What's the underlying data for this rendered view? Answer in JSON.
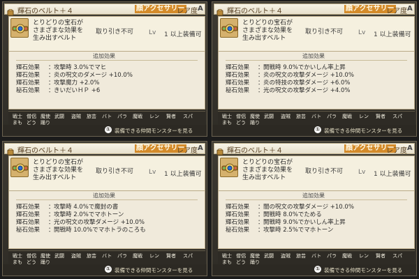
{
  "panels": [
    {
      "title": "輝石のベルト＋４",
      "badge": "顔アクセサリー",
      "rarity_label": "レア度",
      "rarity_value": "A",
      "desc": [
        "とりどりの宝石が",
        "さまざまな効果を",
        "生み出すベルト"
      ],
      "trade": "取り引き不可",
      "level_label": "Lv",
      "level_value": "1 以上装備可",
      "effects_title": "追加効果",
      "effects": [
        {
          "name": "輝石効果",
          "value": "攻撃時 3.0%でマヒ"
        },
        {
          "name": "輝石効果",
          "value": "炎の呪文のダメージ +10.0%"
        },
        {
          "name": "輝石効果",
          "value": "攻撃魔力 +2.0%"
        },
        {
          "name": "秘石効果",
          "value": "きいだいＨＰ +6"
        }
      ],
      "classes_row1": [
        "戦士",
        "僧侶",
        "魔使",
        "武闘",
        "盗賊",
        "旅芸",
        "バト",
        "パラ",
        "魔戦",
        "レン",
        "賢者",
        "スパ"
      ],
      "classes_row2": [
        "まも",
        "どう",
        "踊り"
      ],
      "footer": "装備できる仲間モンスターを見る",
      "footer_icon": "①"
    },
    {
      "title": "輝石のベルト＋４",
      "badge": "顔アクセサリー",
      "rarity_label": "レア度",
      "rarity_value": "A",
      "desc": [
        "とりどりの宝石が",
        "さまざまな効果を",
        "生み出すベルト"
      ],
      "trade": "取り引き不可",
      "level_label": "Lv",
      "level_value": "1 以上装備可",
      "effects_title": "追加効果",
      "effects": [
        {
          "name": "輝石効果",
          "value": "開戦時 9.0%でかいしん率上昇"
        },
        {
          "name": "輝石効果",
          "value": "炎の呪文の攻撃ダメージ +10.0%"
        },
        {
          "name": "輝石効果",
          "value": "炎の特技の攻撃ダメージ +6.0%"
        },
        {
          "name": "秘石効果",
          "value": "光の呪文の攻撃ダメージ +4.0%"
        }
      ],
      "classes_row1": [
        "戦士",
        "僧侶",
        "魔使",
        "武闘",
        "盗賊",
        "旅芸",
        "バト",
        "パラ",
        "魔戦",
        "レン",
        "賢者",
        "スパ"
      ],
      "classes_row2": [
        "まも",
        "どう",
        "踊り"
      ],
      "footer": "装備できる仲間モンスターを見る",
      "footer_icon": "①"
    },
    {
      "title": "輝石のベルト＋４",
      "badge": "顔アクセサリー",
      "rarity_label": "レア度",
      "rarity_value": "A",
      "desc": [
        "とりどりの宝石が",
        "さまざまな効果を",
        "生み出すベルト"
      ],
      "trade": "取り引き不可",
      "level_label": "Lv",
      "level_value": "1 以上装備可",
      "effects_title": "追加効果",
      "effects": [
        {
          "name": "輝石効果",
          "value": "攻撃時 4.0%で魔封の書"
        },
        {
          "name": "輝石効果",
          "value": "攻撃時 2.0%でマホトーン"
        },
        {
          "name": "輝石効果",
          "value": "光の呪文の攻撃ダメージ +10.0%"
        },
        {
          "name": "秘石効果",
          "value": "開戦時 10.0%でマホトラのころも"
        }
      ],
      "classes_row1": [
        "戦士",
        "僧侶",
        "魔使",
        "武闘",
        "盗賊",
        "旅芸",
        "バト",
        "パラ",
        "魔戦",
        "レン",
        "賢者",
        "スパ"
      ],
      "classes_row2": [
        "まも",
        "どう",
        "踊り"
      ],
      "footer": "装備できる仲間モンスターを見る",
      "footer_icon": "①"
    },
    {
      "title": "輝石のベルト＋４",
      "badge": "顔アクセサリー",
      "rarity_label": "レア度",
      "rarity_value": "A",
      "desc": [
        "とりどりの宝石が",
        "さまざまな効果を",
        "生み出すベルト"
      ],
      "trade": "取り引き不可",
      "level_label": "Lv",
      "level_value": "1 以上装備可",
      "effects_title": "追加効果",
      "effects": [
        {
          "name": "輝石効果",
          "value": "闇の呪文の攻撃ダメージ +10.0%"
        },
        {
          "name": "輝石効果",
          "value": "開戦時 8.0%でためる"
        },
        {
          "name": "輝石効果",
          "value": "開戦時 9.0%でかいしん率上昇"
        },
        {
          "name": "秘石効果",
          "value": "攻撃時 2.5%でマホトーン"
        }
      ],
      "classes_row1": [
        "戦士",
        "僧侶",
        "魔使",
        "武闘",
        "盗賊",
        "旅芸",
        "バト",
        "パラ",
        "魔戦",
        "レン",
        "賢者",
        "スパ"
      ],
      "classes_row2": [
        "まも",
        "どう",
        "踊り"
      ],
      "footer": "装備できる仲間モンスターを見る",
      "footer_icon": "①"
    }
  ]
}
